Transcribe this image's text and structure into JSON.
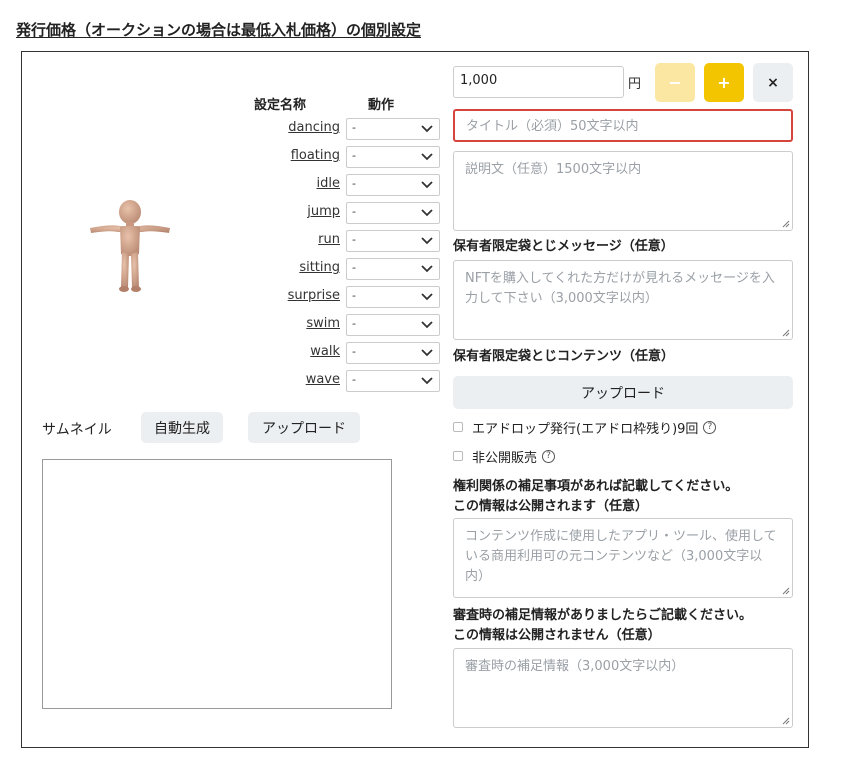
{
  "page_title": "発行価格（オークションの場合は最低入札価格）の個別設定",
  "motions": {
    "header_name": "設定名称",
    "header_action": "動作",
    "items": [
      {
        "name": "dancing",
        "value": "-"
      },
      {
        "name": "floating",
        "value": "-"
      },
      {
        "name": "idle",
        "value": "-"
      },
      {
        "name": "jump",
        "value": "-"
      },
      {
        "name": "run",
        "value": "-"
      },
      {
        "name": "sitting",
        "value": "-"
      },
      {
        "name": "surprise",
        "value": "-"
      },
      {
        "name": "swim",
        "value": "-"
      },
      {
        "name": "walk",
        "value": "-"
      },
      {
        "name": "wave",
        "value": "-"
      }
    ]
  },
  "thumbnail": {
    "label": "サムネイル",
    "auto_generate": "自動生成",
    "upload": "アップロード"
  },
  "price": {
    "value": "1,000",
    "unit": "円",
    "minus": "−",
    "plus": "+",
    "close": "×"
  },
  "colors": {
    "accent_yellow": "#f2c500",
    "accent_yellow_light": "#fbe7a1",
    "error_red": "#d6453c"
  },
  "form": {
    "title_placeholder": "タイトル（必須）50文字以内",
    "description_placeholder": "説明文（任意）1500文字以内",
    "holder_message_label": "保有者限定袋とじメッセージ（任意）",
    "holder_message_placeholder": "NFTを購入してくれた方だけが見れるメッセージを入力して下さい（3,000文字以内）",
    "holder_content_label": "保有者限定袋とじコンテンツ（任意）",
    "upload_button": "アップロード",
    "airdrop_label": "エアドロップ発行(エアドロ枠残り)9回",
    "private_sale_label": "非公開販売",
    "rights_label_1": "権利関係の補足事項があれば記載してください。",
    "rights_label_2": "この情報は公開されます（任意）",
    "rights_placeholder": "コンテンツ作成に使用したアプリ・ツール、使用している商用利用可の元コンテンツなど（3,000文字以内）",
    "review_label_1": "審査時の補足情報がありましたらご記載ください。",
    "review_label_2": "この情報は公開されません（任意）",
    "review_placeholder": "審査時の補足情報（3,000文字以内）"
  }
}
